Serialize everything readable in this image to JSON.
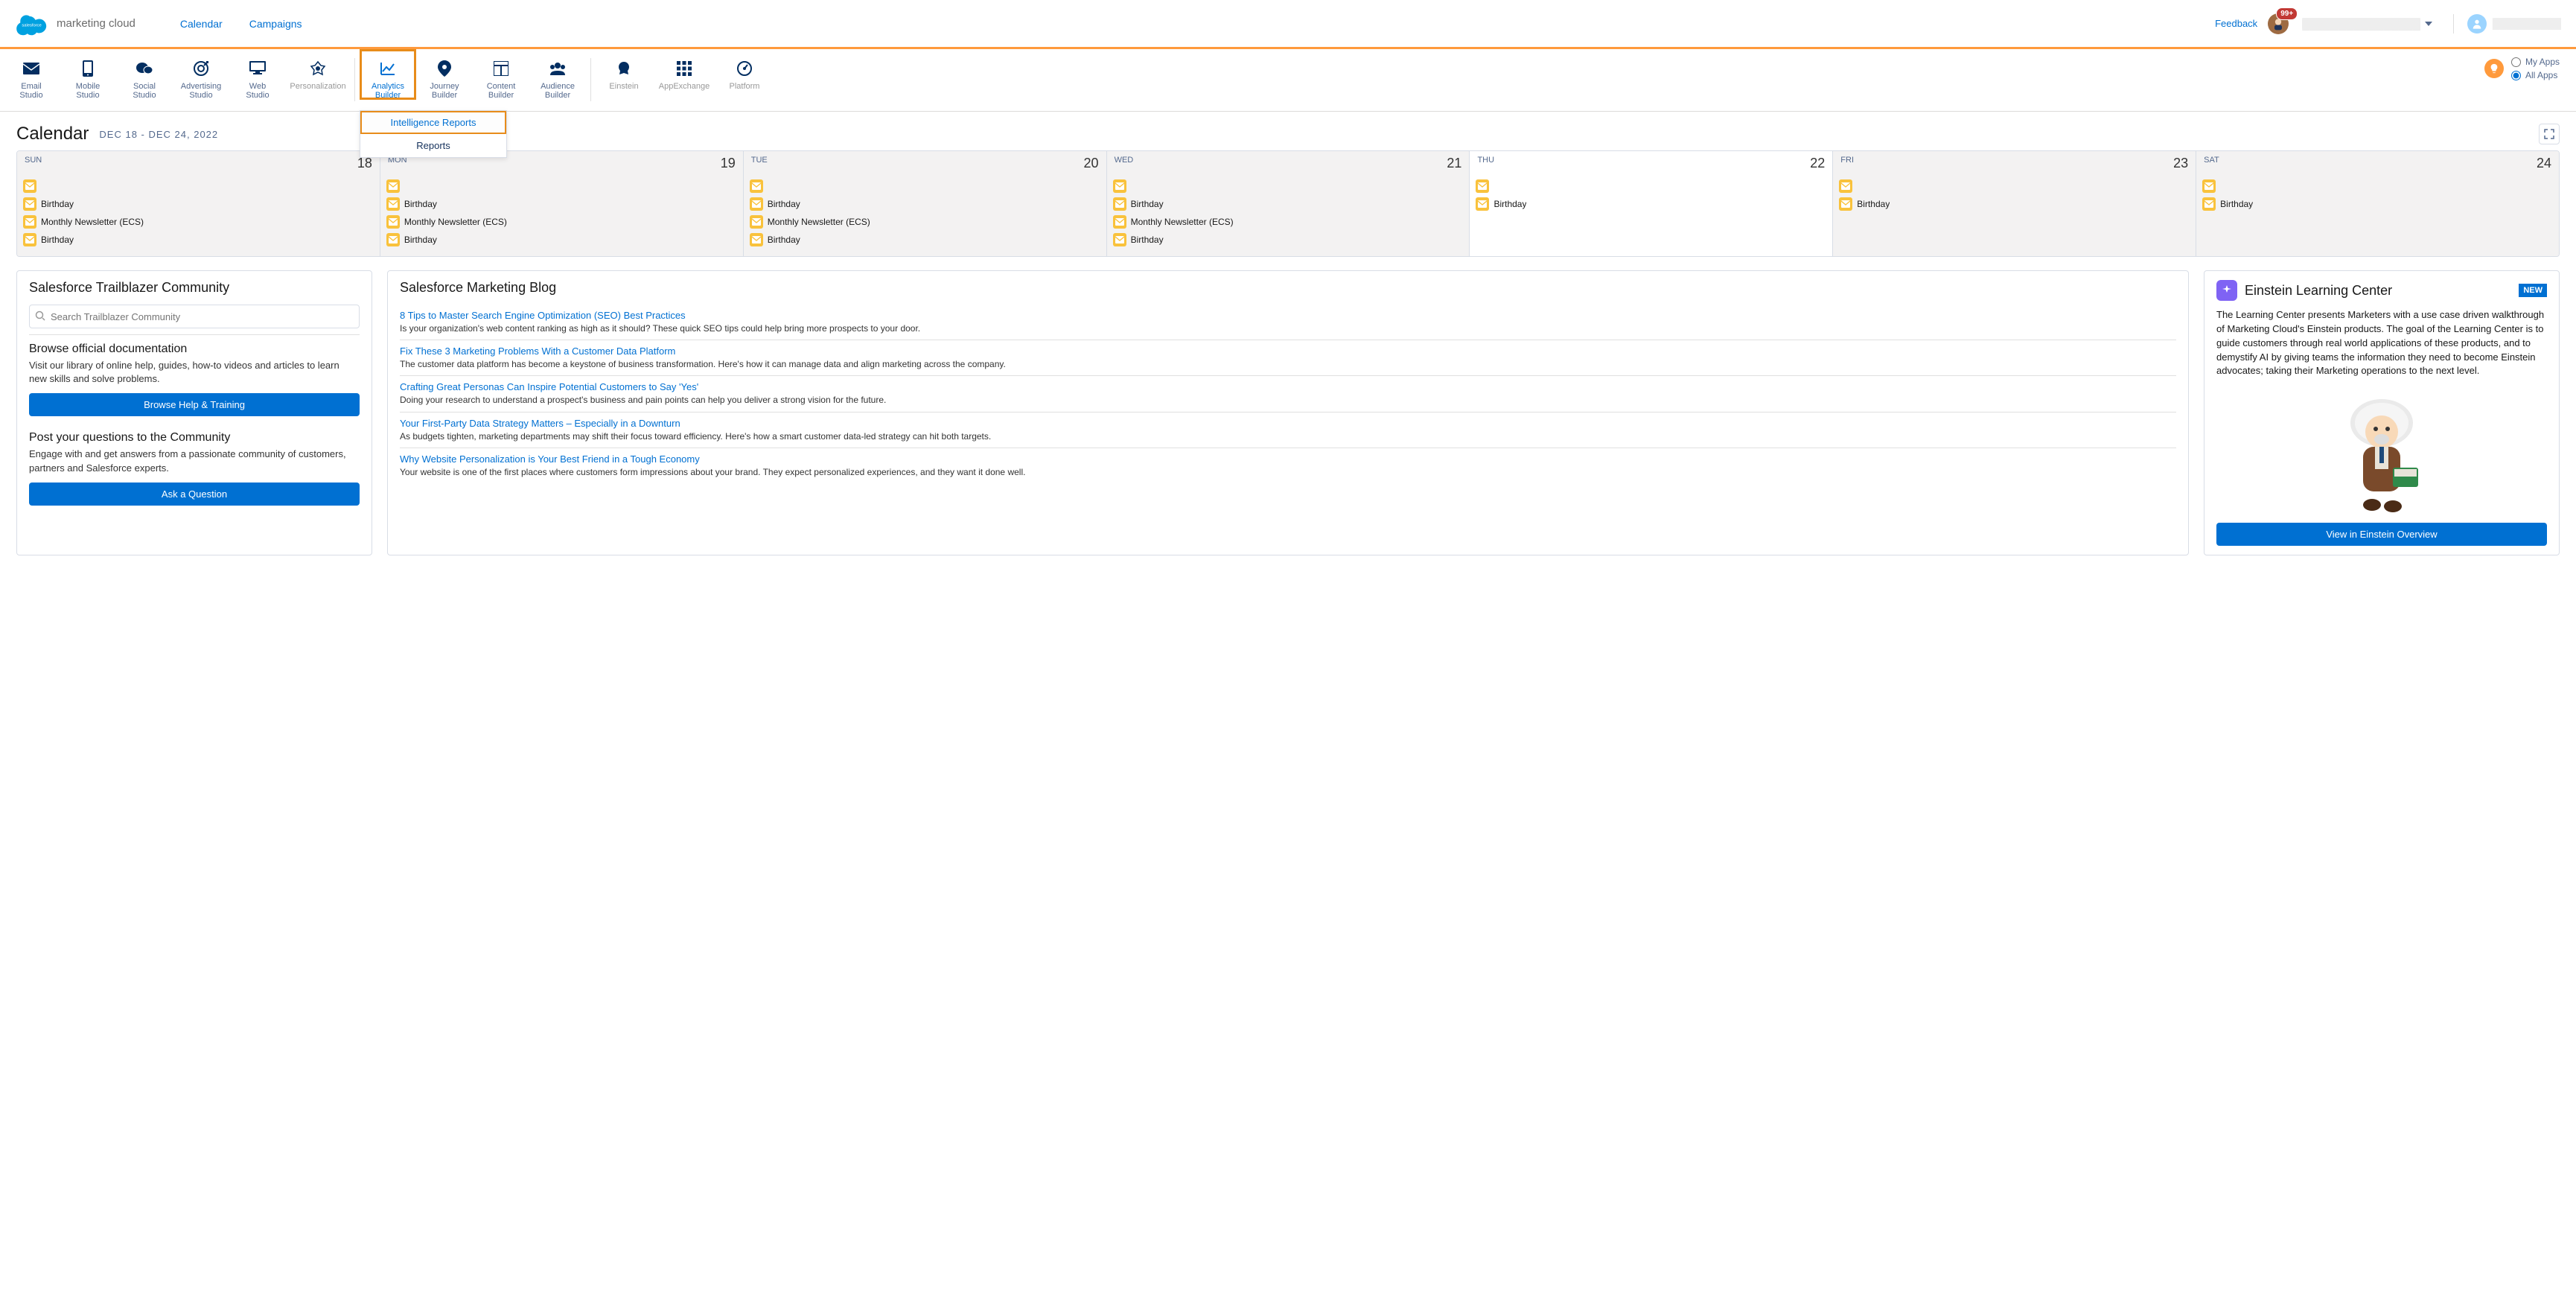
{
  "brand": {
    "product": "marketing cloud"
  },
  "topnav": {
    "calendar": "Calendar",
    "campaigns": "Campaigns"
  },
  "topright": {
    "feedback": "Feedback",
    "badge": "99+",
    "my_apps": "My Apps",
    "all_apps": "All Apps"
  },
  "apps": {
    "email": "Email\nStudio",
    "mobile": "Mobile\nStudio",
    "social": "Social\nStudio",
    "advertising": "Advertising\nStudio",
    "web": "Web\nStudio",
    "personalization": "Personalization",
    "analytics": "Analytics\nBuilder",
    "journey": "Journey\nBuilder",
    "content": "Content\nBuilder",
    "audience": "Audience\nBuilder",
    "einstein": "Einstein",
    "appexchange": "AppExchange",
    "platform": "Platform"
  },
  "dropdown": {
    "intel": "Intelligence Reports",
    "reports": "Reports"
  },
  "page": {
    "title": "Calendar",
    "range": "DEC 18 - DEC 24, 2022"
  },
  "days": [
    {
      "dow": "SUN",
      "num": "18",
      "active": false,
      "events": [
        "",
        "Birthday",
        "Monthly Newsletter (ECS)",
        "Birthday"
      ]
    },
    {
      "dow": "MON",
      "num": "19",
      "active": false,
      "events": [
        "",
        "Birthday",
        "Monthly Newsletter (ECS)",
        "Birthday"
      ]
    },
    {
      "dow": "TUE",
      "num": "20",
      "active": false,
      "events": [
        "",
        "Birthday",
        "Monthly Newsletter (ECS)",
        "Birthday"
      ]
    },
    {
      "dow": "WED",
      "num": "21",
      "active": false,
      "events": [
        "",
        "Birthday",
        "Monthly Newsletter (ECS)",
        "Birthday"
      ]
    },
    {
      "dow": "THU",
      "num": "22",
      "active": true,
      "events": [
        "",
        "Birthday"
      ]
    },
    {
      "dow": "FRI",
      "num": "23",
      "active": false,
      "events": [
        "",
        "Birthday"
      ]
    },
    {
      "dow": "SAT",
      "num": "24",
      "active": false,
      "events": [
        "",
        "Birthday"
      ]
    }
  ],
  "community": {
    "title": "Salesforce Trailblazer Community",
    "search_ph": "Search Trailblazer Community",
    "docs_h": "Browse official documentation",
    "docs_p": "Visit our library of online help, guides, how-to videos and articles to learn new skills and solve problems.",
    "docs_btn": "Browse Help & Training",
    "post_h": "Post your questions to the Community",
    "post_p": "Engage with and get answers from a passionate community of customers, partners and Salesforce experts.",
    "post_btn": "Ask a Question"
  },
  "blog": {
    "title": "Salesforce Marketing Blog",
    "items": [
      {
        "t": "8 Tips to Master Search Engine Optimization (SEO) Best Practices",
        "d": "Is your organization's web content ranking as high as it should? These quick SEO tips could help bring more prospects to your door."
      },
      {
        "t": "Fix These 3 Marketing Problems With a Customer Data Platform",
        "d": "The customer data platform has become a keystone of business transformation. Here's how it can manage data and align marketing across the company."
      },
      {
        "t": "Crafting Great Personas Can Inspire Potential Customers to Say 'Yes'",
        "d": "Doing your research to understand a prospect's business and pain points can help you deliver a strong vision for the future."
      },
      {
        "t": "Your First-Party Data Strategy Matters – Especially in a Downturn",
        "d": "As budgets tighten, marketing departments may shift their focus toward efficiency. Here's how a smart customer data-led strategy can hit both targets."
      },
      {
        "t": "Why Website Personalization is Your Best Friend in a Tough Economy",
        "d": "Your website is one of the first places where customers form impressions about your brand. They expect personalized experiences, and they want it done well."
      }
    ]
  },
  "einstein": {
    "title": "Einstein Learning Center",
    "new": "NEW",
    "desc": "The Learning Center presents Marketers with a use case driven walkthrough of Marketing Cloud's Einstein products. The goal of the Learning Center is to guide customers through real world applications of these products, and to demystify AI by giving teams the information they need to become Einstein advocates; taking their Marketing operations to the next level.",
    "btn": "View in Einstein Overview"
  }
}
